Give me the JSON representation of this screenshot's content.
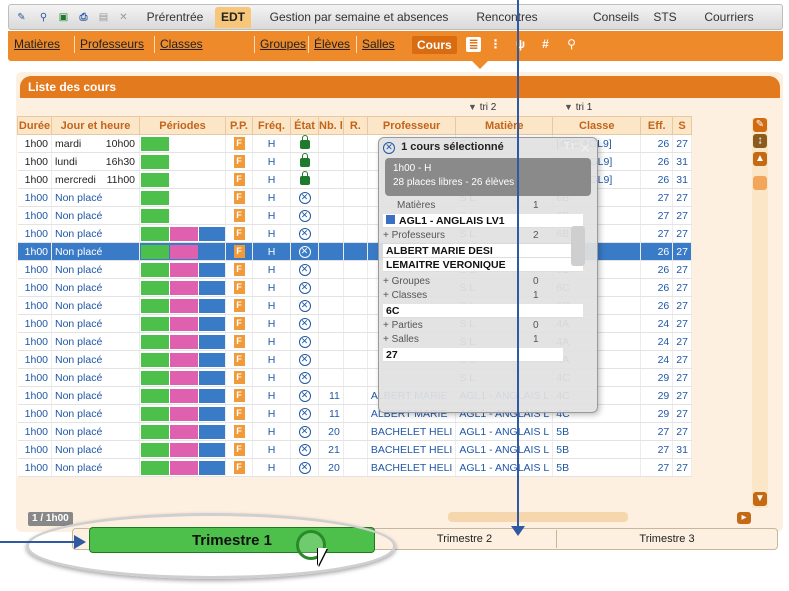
{
  "toolbar": {
    "icons": [
      "edit-menu-icon",
      "search-user-icon",
      "save-icon",
      "print-icon",
      "document-icon",
      "tools-icon"
    ],
    "tabs": [
      "Prérentrée",
      "EDT",
      "Gestion par semaine et absences",
      "Rencontres",
      "Conseils",
      "STS",
      "Courriers"
    ],
    "active_tab": "EDT"
  },
  "submenu": {
    "items": [
      "Matières",
      "Professeurs",
      "Classes",
      "Groupes",
      "Élèves",
      "Salles",
      "Cours"
    ],
    "active": "Cours",
    "icons": [
      "list-icon",
      "grid-icon",
      "chart-icon",
      "calendar-grid-icon",
      "search-icon"
    ]
  },
  "panel": {
    "title": "Liste des cours",
    "sort1": "tri 2",
    "sort2": "tri 1"
  },
  "table": {
    "headers": [
      "Durée",
      "Jour et heure",
      "Périodes",
      "P.P.",
      "Fréq.",
      "État",
      "Nb. l",
      "R.",
      "Professeur",
      "Matière",
      "Classe",
      "Eff.",
      "S"
    ],
    "rows": [
      {
        "duree": "1h00",
        "jour": "mardi",
        "heure": "10h00",
        "pp": "F",
        "freq": "H",
        "etat": "lock",
        "nb": "",
        "prof": "",
        "mat": "S L",
        "classe": "[4BC AGL9]",
        "eff": "26",
        "s": "27",
        "placed": true,
        "periods": "g"
      },
      {
        "duree": "1h00",
        "jour": "lundi",
        "heure": "16h30",
        "pp": "F",
        "freq": "H",
        "etat": "lock",
        "nb": "",
        "prof": "",
        "mat": "S L",
        "classe": "[3CD AGL9]",
        "eff": "26",
        "s": "31",
        "placed": true,
        "periods": "g"
      },
      {
        "duree": "1h00",
        "jour": "mercredi",
        "heure": "11h00",
        "pp": "F",
        "freq": "H",
        "etat": "lock",
        "nb": "",
        "prof": "",
        "mat": "S L",
        "classe": "[3CD AGL9]",
        "eff": "26",
        "s": "31",
        "placed": true,
        "periods": "g"
      },
      {
        "duree": "1h00",
        "jour": "Non placé",
        "heure": "",
        "pp": "F",
        "freq": "H",
        "etat": "x",
        "nb": "",
        "prof": "",
        "mat": "S L",
        "classe": "6B",
        "eff": "27",
        "s": "27",
        "placed": false,
        "periods": "g"
      },
      {
        "duree": "1h00",
        "jour": "Non placé",
        "heure": "",
        "pp": "F",
        "freq": "H",
        "etat": "x",
        "nb": "",
        "prof": "",
        "mat": "S L",
        "classe": "6B",
        "eff": "27",
        "s": "27",
        "placed": false,
        "periods": "g"
      },
      {
        "duree": "1h00",
        "jour": "Non placé",
        "heure": "",
        "pp": "F",
        "freq": "H",
        "etat": "x",
        "nb": "",
        "prof": "",
        "mat": "S L",
        "classe": "6B",
        "eff": "27",
        "s": "27",
        "placed": false,
        "periods": "gpb"
      },
      {
        "duree": "1h00",
        "jour": "Non placé",
        "heure": "",
        "pp": "F",
        "freq": "H",
        "etat": "x",
        "nb": "",
        "prof": "",
        "mat": "S L",
        "classe": "6C",
        "eff": "26",
        "s": "27",
        "placed": false,
        "periods": "gpb",
        "selected": true
      },
      {
        "duree": "1h00",
        "jour": "Non placé",
        "heure": "",
        "pp": "F",
        "freq": "H",
        "etat": "x",
        "nb": "",
        "prof": "",
        "mat": "S L",
        "classe": "6C",
        "eff": "26",
        "s": "27",
        "placed": false,
        "periods": "gpb"
      },
      {
        "duree": "1h00",
        "jour": "Non placé",
        "heure": "",
        "pp": "F",
        "freq": "H",
        "etat": "x",
        "nb": "",
        "prof": "",
        "mat": "S L",
        "classe": "6C",
        "eff": "26",
        "s": "27",
        "placed": false,
        "periods": "gpb"
      },
      {
        "duree": "1h00",
        "jour": "Non placé",
        "heure": "",
        "pp": "F",
        "freq": "H",
        "etat": "x",
        "nb": "",
        "prof": "",
        "mat": "S L",
        "classe": "6C",
        "eff": "26",
        "s": "27",
        "placed": false,
        "periods": "gpb"
      },
      {
        "duree": "1h00",
        "jour": "Non placé",
        "heure": "",
        "pp": "F",
        "freq": "H",
        "etat": "x",
        "nb": "",
        "prof": "",
        "mat": "S L",
        "classe": "4A",
        "eff": "24",
        "s": "27",
        "placed": false,
        "periods": "gpb"
      },
      {
        "duree": "1h00",
        "jour": "Non placé",
        "heure": "",
        "pp": "F",
        "freq": "H",
        "etat": "x",
        "nb": "",
        "prof": "",
        "mat": "S L",
        "classe": "4A",
        "eff": "24",
        "s": "27",
        "placed": false,
        "periods": "gpb"
      },
      {
        "duree": "1h00",
        "jour": "Non placé",
        "heure": "",
        "pp": "F",
        "freq": "H",
        "etat": "x",
        "nb": "",
        "prof": "",
        "mat": "S L",
        "classe": "4A",
        "eff": "24",
        "s": "27",
        "placed": false,
        "periods": "gpb"
      },
      {
        "duree": "1h00",
        "jour": "Non placé",
        "heure": "",
        "pp": "F",
        "freq": "H",
        "etat": "x",
        "nb": "",
        "prof": "",
        "mat": "S L",
        "classe": "4C",
        "eff": "29",
        "s": "27",
        "placed": false,
        "periods": "gpb"
      },
      {
        "duree": "1h00",
        "jour": "Non placé",
        "heure": "",
        "pp": "F",
        "freq": "H",
        "etat": "x",
        "nb": "11",
        "prof": "ALBERT MARIE",
        "mat": "AGL1 - ANGLAIS L",
        "classe": "4C",
        "eff": "29",
        "s": "27",
        "placed": false,
        "periods": "gpb"
      },
      {
        "duree": "1h00",
        "jour": "Non placé",
        "heure": "",
        "pp": "F",
        "freq": "H",
        "etat": "x",
        "nb": "11",
        "prof": "ALBERT MARIE",
        "mat": "AGL1 - ANGLAIS L",
        "classe": "4C",
        "eff": "29",
        "s": "27",
        "placed": false,
        "periods": "gpb"
      },
      {
        "duree": "1h00",
        "jour": "Non placé",
        "heure": "",
        "pp": "F",
        "freq": "H",
        "etat": "x",
        "nb": "20",
        "prof": "BACHELET HELI",
        "mat": "AGL1 - ANGLAIS L",
        "classe": "5B",
        "eff": "27",
        "s": "27",
        "placed": false,
        "periods": "gpb"
      },
      {
        "duree": "1h00",
        "jour": "Non placé",
        "heure": "",
        "pp": "F",
        "freq": "H",
        "etat": "x",
        "nb": "21",
        "prof": "BACHELET HELI",
        "mat": "AGL1 - ANGLAIS L",
        "classe": "5B",
        "eff": "27",
        "s": "31",
        "placed": false,
        "periods": "gpb"
      },
      {
        "duree": "1h00",
        "jour": "Non placé",
        "heure": "",
        "pp": "F",
        "freq": "H",
        "etat": "x",
        "nb": "20",
        "prof": "BACHELET HELI",
        "mat": "AGL1 - ANGLAIS L",
        "classe": "5B",
        "eff": "27",
        "s": "27",
        "placed": false,
        "periods": "gpb"
      }
    ]
  },
  "popup": {
    "title": "1 cours sélectionné",
    "line1": "1h00 - H",
    "line2": "28 places libres - 26 élèves",
    "sec_matieres": "Matières",
    "cnt_matieres": "1",
    "matiere": "AGL1 - ANGLAIS LV1",
    "sec_profs": "+ Professeurs",
    "cnt_profs": "2",
    "prof1": "ALBERT MARIE DESI",
    "prof2": "LEMAITRE VERONIQUE",
    "sec_groupes": "+ Groupes",
    "cnt_groupes": "0",
    "sec_classes": "+ Classes",
    "cnt_classes": "1",
    "classe": "6C",
    "sec_parties": "+ Parties",
    "cnt_parties": "0",
    "sec_salles": "+ Salles",
    "cnt_salles": "1",
    "salle": "27"
  },
  "pager": "1 / 1h00",
  "trimestres": [
    "Trimestre 1",
    "Trimestre 2",
    "Trimestre 3"
  ],
  "colors": {
    "orange": "#ee8a2a",
    "green": "#4cc04a",
    "pink": "#e060b0",
    "blue": "#3a7bc8"
  }
}
